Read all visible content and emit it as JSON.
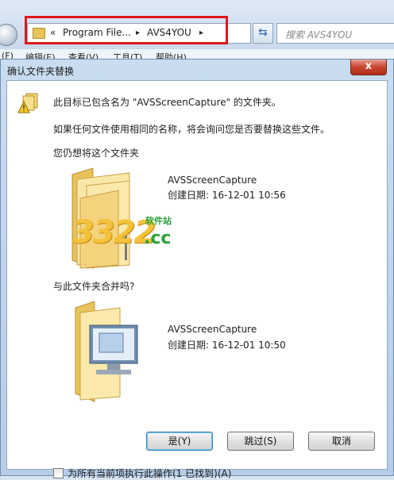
{
  "explorer": {
    "breadcrumb_prefix": "«",
    "breadcrumb_1": "Program File...",
    "breadcrumb_sep": "▸",
    "breadcrumb_2": "AVS4YOU",
    "breadcrumb_end": "▸",
    "search_placeholder": "搜索 AVS4YOU",
    "menu": [
      "(F)",
      "编辑(E)",
      "查看(V)",
      "工具(T)",
      "帮助(H)"
    ]
  },
  "dialog": {
    "title": "确认文件夹替换",
    "close_label": "x",
    "message": "此目标已包含名为 \"AVSScreenCapture\" 的文件夹。",
    "explain": "如果任何文件使用相同的名称，将会询问您是否要替换这些文件。",
    "question_keep": "您仍想将这个文件夹",
    "folder1": {
      "name": "AVSScreenCapture",
      "date": "创建日期: 16-12-01 10:56"
    },
    "question_merge": "与此文件夹合并吗?",
    "folder2": {
      "name": "AVSScreenCapture",
      "date": "创建日期: 16-12-01 10:50"
    },
    "buttons": {
      "yes": "是(Y)",
      "skip": "跳过(S)",
      "cancel": "取消"
    },
    "apply_all": "为所有当前项执行此操作(1 已找到)(A)"
  },
  "watermark": {
    "number": "3322",
    "site_cn": "软件站",
    "domain": ".cc"
  },
  "colors": {
    "highlight": "#e0161b",
    "folder": "#e8c459",
    "watermark_green": "#2aa23a"
  }
}
